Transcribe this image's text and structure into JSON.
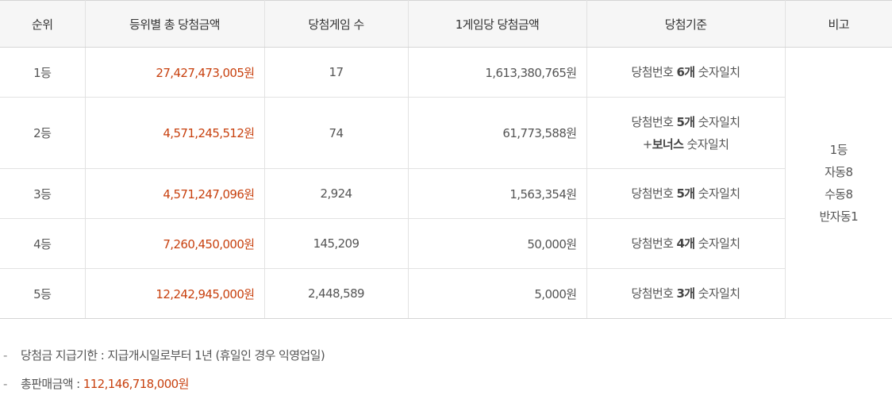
{
  "headers": [
    "순위",
    "등위별 총 당첨금액",
    "당첨게임 수",
    "1게임당 당첨금액",
    "당첨기준",
    "비고"
  ],
  "rows": [
    {
      "rank": "1등",
      "total": "27,427,473,005원",
      "count": "17",
      "per_game": "1,613,380,765원",
      "crit_pre": "당첨번호 ",
      "crit_num": "6개",
      "crit_post": " 숫자일치"
    },
    {
      "rank": "2등",
      "total": "4,571,245,512원",
      "count": "74",
      "per_game": "61,773,588원",
      "crit_pre": "당첨번호 ",
      "crit_num": "5개",
      "crit_post": " 숫자일치",
      "crit2_pre": "+",
      "crit2_bold": "보너스",
      "crit2_post": " 숫자일치"
    },
    {
      "rank": "3등",
      "total": "4,571,247,096원",
      "count": "2,924",
      "per_game": "1,563,354원",
      "crit_pre": "당첨번호 ",
      "crit_num": "5개",
      "crit_post": " 숫자일치"
    },
    {
      "rank": "4등",
      "total": "7,260,450,000원",
      "count": "145,209",
      "per_game": "50,000원",
      "crit_pre": "당첨번호 ",
      "crit_num": "4개",
      "crit_post": " 숫자일치"
    },
    {
      "rank": "5등",
      "total": "12,242,945,000원",
      "count": "2,448,589",
      "per_game": "5,000원",
      "crit_pre": "당첨번호 ",
      "crit_num": "3개",
      "crit_post": " 숫자일치"
    }
  ],
  "remark": [
    "1등",
    "자동8",
    "수동8",
    "반자동1"
  ],
  "notes": {
    "dash": "-",
    "deadline": "당첨금 지급기한 : 지급개시일로부터 1년 (휴일인 경우 익영업일)",
    "sales_label": "총판매금액 : ",
    "sales_value": "112,146,718,000원"
  },
  "colors": {
    "accent_red": "#c8410f",
    "header_bg": "#f6f6f6",
    "border": "#e2e2e2"
  }
}
